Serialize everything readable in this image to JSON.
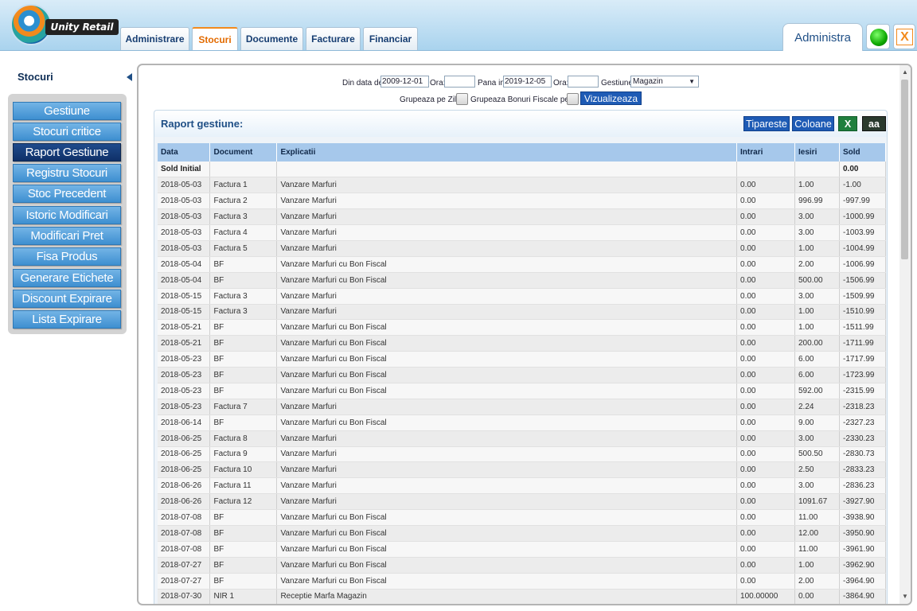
{
  "header": {
    "logo_text": "Unity Retail",
    "tabs": [
      {
        "label": "Administrare"
      },
      {
        "label": "Stocuri"
      },
      {
        "label": "Documente"
      },
      {
        "label": "Facturare"
      },
      {
        "label": "Financiar"
      }
    ],
    "user_tab": "Administra",
    "close_label": "X",
    "status_color": "#0ea800",
    "accent_color": "#f28a1d"
  },
  "sidebar": {
    "title": "Stocuri",
    "items": [
      {
        "label": "Gestiune"
      },
      {
        "label": "Stocuri critice"
      },
      {
        "label": "Raport Gestiune"
      },
      {
        "label": "Registru Stocuri"
      },
      {
        "label": "Stoc Precedent"
      },
      {
        "label": "Istoric Modificari"
      },
      {
        "label": "Modificari Pret"
      },
      {
        "label": "Fisa Produs"
      },
      {
        "label": "Generare Etichete"
      },
      {
        "label": "Discount Expirare"
      },
      {
        "label": "Lista Expirare"
      }
    ]
  },
  "filters": {
    "from_label": "Din data de",
    "from_value": "2009-12-01",
    "ora1_label": "Ora:",
    "ora1_value": "",
    "to_label": "Pana in",
    "to_value": "2019-12-05",
    "ora2_label": "Ora:",
    "ora2_value": "",
    "gestiune_label": "Gestiune:",
    "gestiune_value": "Magazin",
    "group_days_label": "Grupeaza pe Zile",
    "group_bf_label": "Grupeaza Bonuri Fiscale pe Z",
    "view_button": "Vizualizeaza"
  },
  "report": {
    "title": "Raport gestiune:",
    "print_button": "Tipareste",
    "columns_button": "Coloane",
    "excel_button": "X",
    "font_button": "aa",
    "headers": [
      "Data",
      "Document",
      "Explicatii",
      "Intrari",
      "Iesiri",
      "Sold"
    ],
    "initial": {
      "label": "Sold Initial",
      "sold": "0.00"
    },
    "rows": [
      [
        "2018-05-03",
        "Factura 1",
        "Vanzare Marfuri",
        "0.00",
        "1.00",
        "-1.00"
      ],
      [
        "2018-05-03",
        "Factura 2",
        "Vanzare Marfuri",
        "0.00",
        "996.99",
        "-997.99"
      ],
      [
        "2018-05-03",
        "Factura 3",
        "Vanzare Marfuri",
        "0.00",
        "3.00",
        "-1000.99"
      ],
      [
        "2018-05-03",
        "Factura 4",
        "Vanzare Marfuri",
        "0.00",
        "3.00",
        "-1003.99"
      ],
      [
        "2018-05-03",
        "Factura 5",
        "Vanzare Marfuri",
        "0.00",
        "1.00",
        "-1004.99"
      ],
      [
        "2018-05-04",
        "BF",
        "Vanzare Marfuri cu Bon Fiscal",
        "0.00",
        "2.00",
        "-1006.99"
      ],
      [
        "2018-05-04",
        "BF",
        "Vanzare Marfuri cu Bon Fiscal",
        "0.00",
        "500.00",
        "-1506.99"
      ],
      [
        "2018-05-15",
        "Factura 3",
        "Vanzare Marfuri",
        "0.00",
        "3.00",
        "-1509.99"
      ],
      [
        "2018-05-15",
        "Factura 3",
        "Vanzare Marfuri",
        "0.00",
        "1.00",
        "-1510.99"
      ],
      [
        "2018-05-21",
        "BF",
        "Vanzare Marfuri cu Bon Fiscal",
        "0.00",
        "1.00",
        "-1511.99"
      ],
      [
        "2018-05-21",
        "BF",
        "Vanzare Marfuri cu Bon Fiscal",
        "0.00",
        "200.00",
        "-1711.99"
      ],
      [
        "2018-05-23",
        "BF",
        "Vanzare Marfuri cu Bon Fiscal",
        "0.00",
        "6.00",
        "-1717.99"
      ],
      [
        "2018-05-23",
        "BF",
        "Vanzare Marfuri cu Bon Fiscal",
        "0.00",
        "6.00",
        "-1723.99"
      ],
      [
        "2018-05-23",
        "BF",
        "Vanzare Marfuri cu Bon Fiscal",
        "0.00",
        "592.00",
        "-2315.99"
      ],
      [
        "2018-05-23",
        "Factura 7",
        "Vanzare Marfuri",
        "0.00",
        "2.24",
        "-2318.23"
      ],
      [
        "2018-06-14",
        "BF",
        "Vanzare Marfuri cu Bon Fiscal",
        "0.00",
        "9.00",
        "-2327.23"
      ],
      [
        "2018-06-25",
        "Factura 8",
        "Vanzare Marfuri",
        "0.00",
        "3.00",
        "-2330.23"
      ],
      [
        "2018-06-25",
        "Factura 9",
        "Vanzare Marfuri",
        "0.00",
        "500.50",
        "-2830.73"
      ],
      [
        "2018-06-25",
        "Factura 10",
        "Vanzare Marfuri",
        "0.00",
        "2.50",
        "-2833.23"
      ],
      [
        "2018-06-26",
        "Factura 11",
        "Vanzare Marfuri",
        "0.00",
        "3.00",
        "-2836.23"
      ],
      [
        "2018-06-26",
        "Factura 12",
        "Vanzare Marfuri",
        "0.00",
        "1091.67",
        "-3927.90"
      ],
      [
        "2018-07-08",
        "BF",
        "Vanzare Marfuri cu Bon Fiscal",
        "0.00",
        "11.00",
        "-3938.90"
      ],
      [
        "2018-07-08",
        "BF",
        "Vanzare Marfuri cu Bon Fiscal",
        "0.00",
        "12.00",
        "-3950.90"
      ],
      [
        "2018-07-08",
        "BF",
        "Vanzare Marfuri cu Bon Fiscal",
        "0.00",
        "11.00",
        "-3961.90"
      ],
      [
        "2018-07-27",
        "BF",
        "Vanzare Marfuri cu Bon Fiscal",
        "0.00",
        "1.00",
        "-3962.90"
      ],
      [
        "2018-07-27",
        "BF",
        "Vanzare Marfuri cu Bon Fiscal",
        "0.00",
        "2.00",
        "-3964.90"
      ],
      [
        "2018-07-30",
        "NIR 1",
        "Receptie Marfa Magazin",
        "100.00000",
        "0.00",
        "-3864.90"
      ]
    ]
  }
}
